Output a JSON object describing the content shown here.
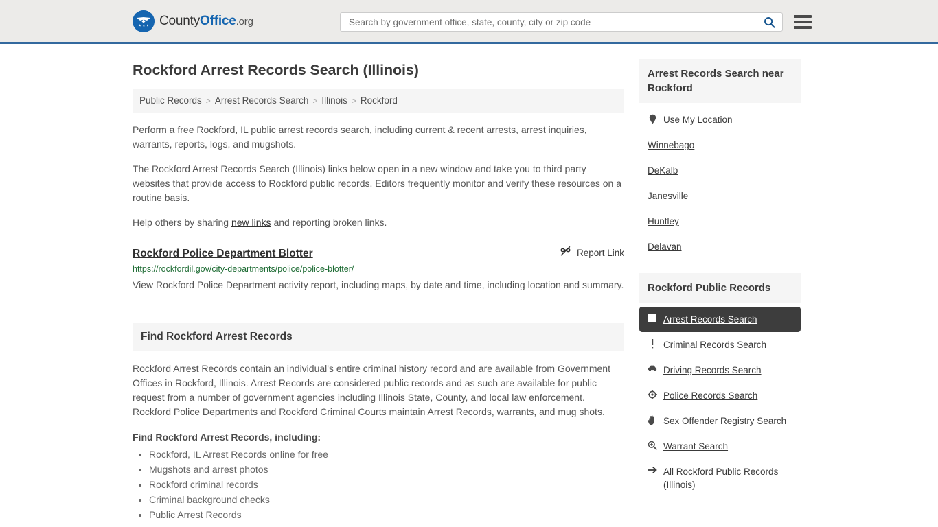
{
  "header": {
    "logo_text_1": "County",
    "logo_text_2": "Office",
    "logo_text_3": ".org",
    "search_placeholder": "Search by government office, state, county, city or zip code",
    "search_value": "",
    "search_icon": "search-icon",
    "menu_icon": "hamburger-menu-icon",
    "accent_color": "#33699e",
    "bg_color": "#ecebe9"
  },
  "main": {
    "title": "Rockford Arrest Records Search (Illinois)",
    "breadcrumb": [
      {
        "label": "Public Records"
      },
      {
        "label": "Arrest Records Search"
      },
      {
        "label": "Illinois"
      },
      {
        "label": "Rockford"
      }
    ],
    "breadcrumb_separator": ">",
    "intro_1": "Perform a free Rockford, IL public arrest records search, including current & recent arrests, arrest inquiries, warrants, reports, logs, and mugshots.",
    "intro_2": "The Rockford Arrest Records Search (Illinois) links below open in a new window and take you to third party websites that provide access to Rockford public records. Editors frequently monitor and verify these resources on a routine basis.",
    "intro_3_pre": "Help others by sharing ",
    "intro_3_link": "new links",
    "intro_3_post": " and reporting broken links.",
    "result": {
      "title": "Rockford Police Department Blotter",
      "report_label": "Report Link",
      "report_icon": "broken-link-icon",
      "url": "https://rockfordil.gov/city-departments/police/police-blotter/",
      "url_color": "#1d6b33",
      "description": "View Rockford Police Department activity report, including maps, by date and time, including location and summary."
    },
    "section": {
      "heading": "Find Rockford Arrest Records",
      "paragraph": "Rockford Arrest Records contain an individual's entire criminal history record and are available from Government Offices in Rockford, Illinois. Arrest Records are considered public records and as such are available for public request from a number of government agencies including Illinois State, County, and local law enforcement. Rockford Police Departments and Rockford Criminal Courts maintain Arrest Records, warrants, and mug shots.",
      "list_heading": "Find Rockford Arrest Records, including:",
      "list": [
        "Rockford, IL Arrest Records online for free",
        "Mugshots and arrest photos",
        "Rockford criminal records",
        "Criminal background checks",
        "Public Arrest Records"
      ]
    }
  },
  "sidebar": {
    "near_panel": {
      "heading": "Arrest Records Search near Rockford",
      "items": [
        {
          "label": "Use My Location",
          "icon": "map-pin-icon",
          "has_icon": true
        },
        {
          "label": "Winnebago",
          "icon": "",
          "has_icon": false
        },
        {
          "label": "DeKalb",
          "icon": "",
          "has_icon": false
        },
        {
          "label": "Janesville",
          "icon": "",
          "has_icon": false
        },
        {
          "label": "Huntley",
          "icon": "",
          "has_icon": false
        },
        {
          "label": "Delavan",
          "icon": "",
          "has_icon": false
        }
      ]
    },
    "records_panel": {
      "heading": "Rockford Public Records",
      "active_bg": "#3d3d3d",
      "items": [
        {
          "label": "Arrest Records Search",
          "icon": "square-icon",
          "active": true
        },
        {
          "label": "Criminal Records Search",
          "icon": "exclamation-icon",
          "active": false
        },
        {
          "label": "Driving Records Search",
          "icon": "car-icon",
          "active": false
        },
        {
          "label": "Police Records Search",
          "icon": "target-icon",
          "active": false
        },
        {
          "label": "Sex Offender Registry Search",
          "icon": "hand-icon",
          "active": false
        },
        {
          "label": "Warrant Search",
          "icon": "magnifier-plus-icon",
          "active": false
        },
        {
          "label": "All Rockford Public Records (Illinois)",
          "icon": "arrow-right-icon",
          "active": false
        }
      ]
    }
  }
}
